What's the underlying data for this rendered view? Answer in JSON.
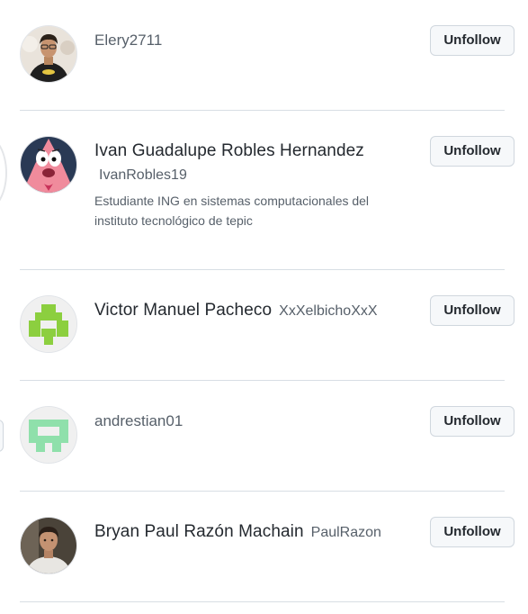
{
  "users": [
    {
      "full_name": "",
      "login": "Elery2711",
      "bio": "",
      "button_label": "Unfollow",
      "avatar": "photo-man-glasses-batman-shirt"
    },
    {
      "full_name": "Ivan Guadalupe Robles Hernandez",
      "login": "IvanRobles19",
      "bio": "Estudiante ING en sistemas computacionales del instituto tecnológico de tepic",
      "button_label": "Unfollow",
      "avatar": "patrick-star-cartoon"
    },
    {
      "full_name": "Victor Manuel Pacheco",
      "login": "XxXelbichoXxX",
      "bio": "",
      "button_label": "Unfollow",
      "avatar": "identicon-green",
      "avatar_color": "#8ccf3f"
    },
    {
      "full_name": "",
      "login": "andrestian01",
      "bio": "",
      "button_label": "Unfollow",
      "avatar": "identicon-mint",
      "avatar_color": "#8fe0ab"
    },
    {
      "full_name": "Bryan Paul Razón Machain",
      "login": "PaulRazon",
      "bio": "",
      "button_label": "Unfollow",
      "avatar": "photo-young-man"
    }
  ]
}
